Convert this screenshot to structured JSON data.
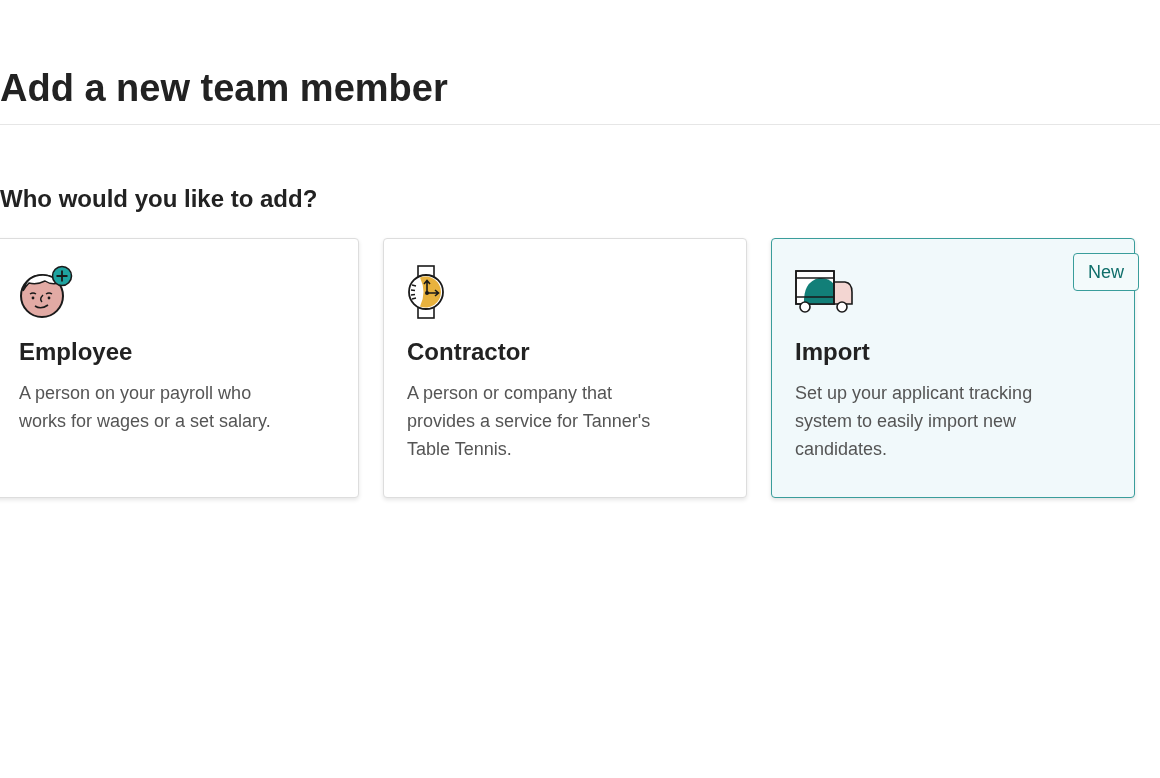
{
  "page": {
    "title": "Add a new team member"
  },
  "section": {
    "heading": "Who would you like to add?"
  },
  "options": [
    {
      "kind": "employee",
      "title": "Employee",
      "description": "A person on your payroll who works for wages or a set salary.",
      "selected": false
    },
    {
      "kind": "contractor",
      "title": "Contractor",
      "description": "A person or company that provides a service for Tanner's Table Tennis.",
      "selected": false
    },
    {
      "kind": "import",
      "title": "Import",
      "description": "Set up your applicant tracking system to easily import new candidates.",
      "selected": true,
      "badge": "New"
    }
  ]
}
